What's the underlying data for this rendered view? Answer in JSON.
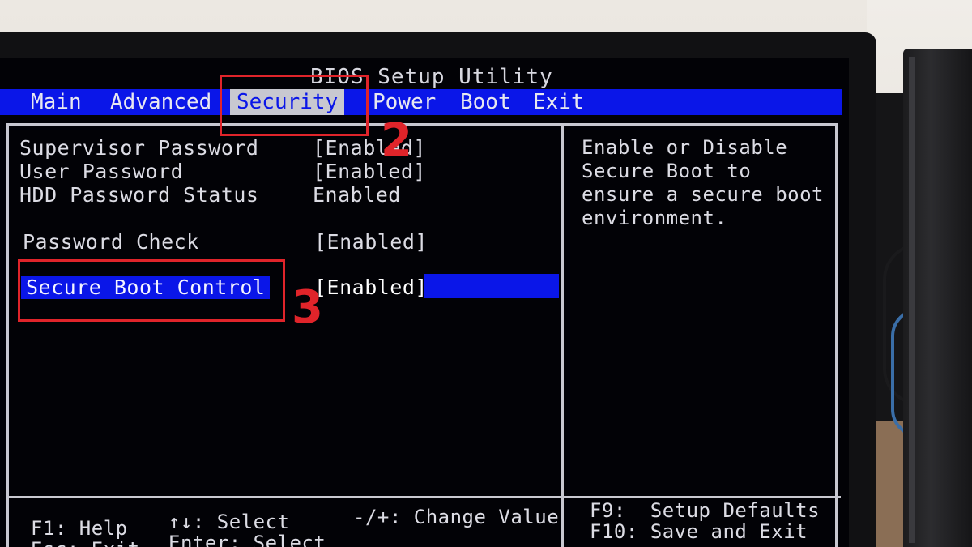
{
  "bios": {
    "title": "BIOS Setup Utility",
    "tabs": [
      {
        "label": "Main"
      },
      {
        "label": "Advanced"
      },
      {
        "label": "Security"
      },
      {
        "label": "Power"
      },
      {
        "label": "Boot"
      },
      {
        "label": "Exit"
      }
    ],
    "selected_tab": "Security",
    "settings": [
      {
        "label": "Supervisor Password",
        "value": "[Enabled]"
      },
      {
        "label": "User Password",
        "value": "[Enabled]"
      },
      {
        "label": "HDD Password Status",
        "value": "Enabled"
      },
      {
        "label": "Password Check",
        "value": "[Enabled]"
      },
      {
        "label": "Secure Boot Control",
        "value": "[Enabled]"
      }
    ],
    "selected_setting": "Secure Boot Control",
    "help": [
      "Enable or Disable",
      "Secure Boot to",
      "ensure a secure boot",
      "environment."
    ],
    "footer": {
      "f1": "F1: Help",
      "arrows": "↑↓: Select",
      "change": "-/+: Change Value",
      "f9": "F9:  Setup Defaults",
      "f10": "F10: Save and Exit",
      "esc": "Esc: Exit",
      "enter": "Enter: Select"
    }
  },
  "annotations": {
    "step2": "2",
    "step3": "3"
  },
  "colors": {
    "bios_blue": "#0a16e8",
    "annotation_red": "#e0242a"
  }
}
